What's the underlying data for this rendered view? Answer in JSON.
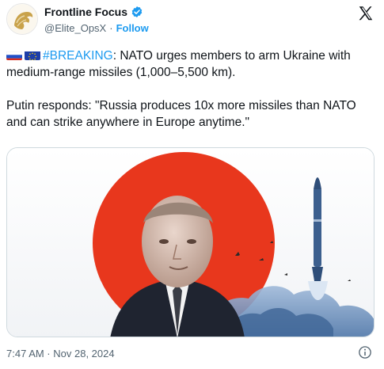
{
  "author": {
    "display_name": "Frontline Focus",
    "handle": "@Elite_OpsX",
    "separator": "·",
    "follow_label": "Follow"
  },
  "icons": {
    "avatar": "lion-logo-icon",
    "verified": "verified-badge-icon",
    "platform": "x-logo-icon",
    "info": "info-icon",
    "flag_1": "russia-flag-icon",
    "flag_2": "eu-flag-icon"
  },
  "tweet": {
    "hashtag": "#BREAKING",
    "line1_rest": ": NATO urges members to arm Ukraine with medium-range missiles (1,000–5,500 km).",
    "paragraph2": "Putin responds: \"Russia produces 10x more missiles than NATO and can strike anywhere in Europe anytime.\""
  },
  "media": {
    "image_subject": "photo-collage-portrait-red-sun-missile-launch"
  },
  "footer": {
    "timestamp": "7:47 AM · Nov 28, 2024"
  },
  "colors": {
    "accent": "#1d9bf0",
    "text": "#0f1419",
    "muted": "#536471",
    "sun": "#e8371d",
    "avatar_gold": "#c9a24a"
  }
}
